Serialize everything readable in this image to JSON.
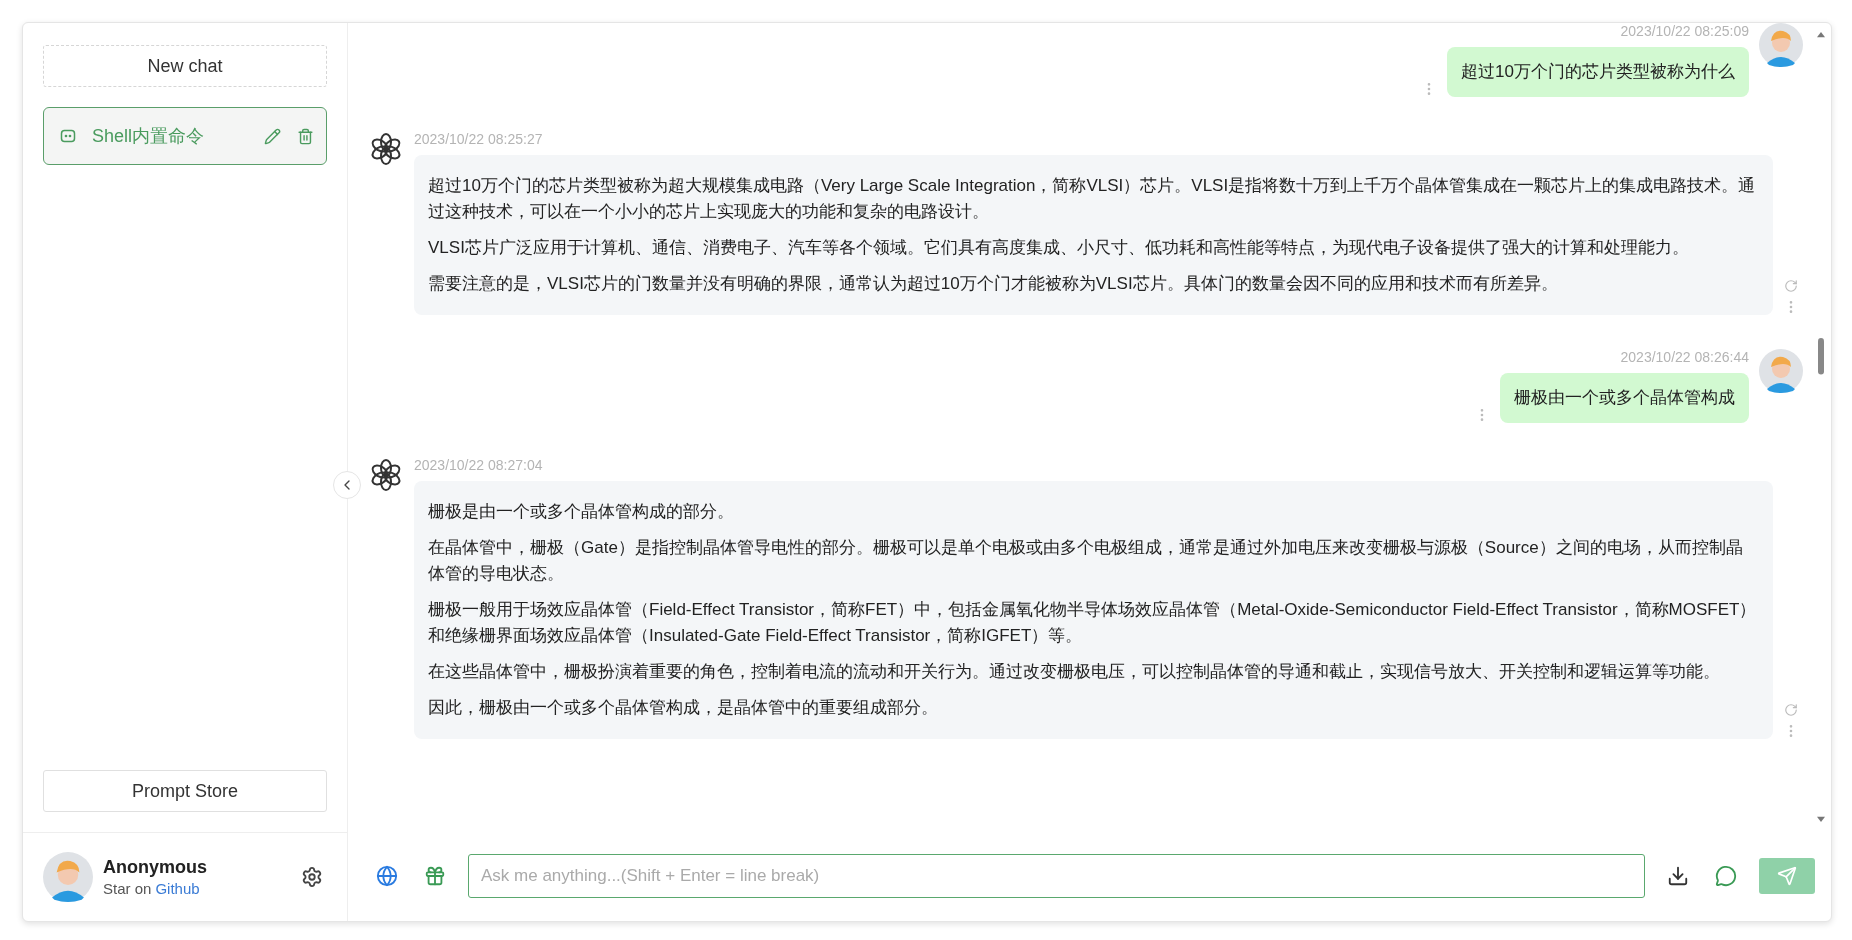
{
  "sidebar": {
    "new_chat": "New chat",
    "chats": [
      {
        "title": "Shell内置命令",
        "selected": true
      }
    ],
    "prompt_store": "Prompt Store",
    "user": {
      "name": "Anonymous",
      "subtitle": "Star on",
      "link": "Github"
    }
  },
  "messages": [
    {
      "kind": "user",
      "time": "2023/10/22 08:25:09",
      "paragraphs": [
        "超过10万个门的芯片类型被称为什么"
      ]
    },
    {
      "kind": "assistant",
      "time": "2023/10/22 08:25:27",
      "paragraphs": [
        "超过10万个门的芯片类型被称为超大规模集成电路（Very Large Scale Integration，简称VLSI）芯片。VLSI是指将数十万到上千万个晶体管集成在一颗芯片上的集成电路技术。通过这种技术，可以在一个小小的芯片上实现庞大的功能和复杂的电路设计。",
        "VLSI芯片广泛应用于计算机、通信、消费电子、汽车等各个领域。它们具有高度集成、小尺寸、低功耗和高性能等特点，为现代电子设备提供了强大的计算和处理能力。",
        "需要注意的是，VLSI芯片的门数量并没有明确的界限，通常认为超过10万个门才能被称为VLSI芯片。具体门的数量会因不同的应用和技术而有所差异。"
      ]
    },
    {
      "kind": "user",
      "time": "2023/10/22 08:26:44",
      "paragraphs": [
        "栅极由一个或多个晶体管构成"
      ]
    },
    {
      "kind": "assistant",
      "time": "2023/10/22 08:27:04",
      "paragraphs": [
        "栅极是由一个或多个晶体管构成的部分。",
        "在晶体管中，栅极（Gate）是指控制晶体管导电性的部分。栅极可以是单个电极或由多个电极组成，通常是通过外加电压来改变栅极与源极（Source）之间的电场，从而控制晶体管的导电状态。",
        "栅极一般用于场效应晶体管（Field-Effect Transistor，简称FET）中，包括金属氧化物半导体场效应晶体管（Metal-Oxide-Semiconductor Field-Effect Transistor，简称MOSFET）和绝缘栅界面场效应晶体管（Insulated-Gate Field-Effect Transistor，简称IGFET）等。",
        "在这些晶体管中，栅极扮演着重要的角色，控制着电流的流动和开关行为。通过改变栅极电压，可以控制晶体管的导通和截止，实现信号放大、开关控制和逻辑运算等功能。",
        "因此，栅极由一个或多个晶体管构成，是晶体管中的重要组成部分。"
      ]
    }
  ],
  "input": {
    "placeholder": "Ask me anything...(Shift + Enter = line break)"
  }
}
